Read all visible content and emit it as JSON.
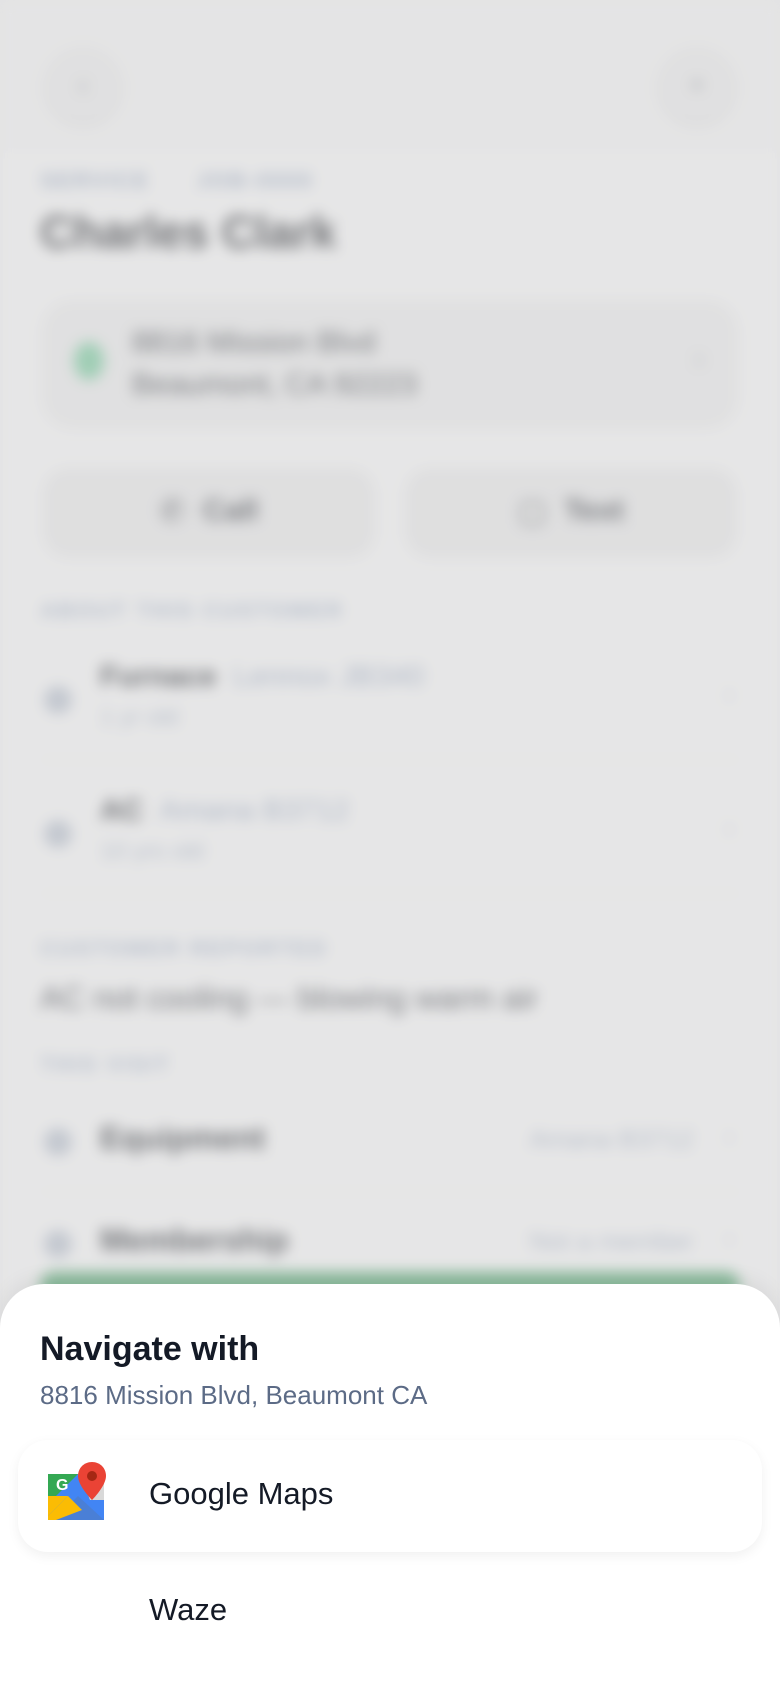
{
  "background": {
    "breadcrumb": [
      "SERVICE",
      "JOB-0000"
    ],
    "customer_name": "Charles Clark",
    "address": {
      "line1": "8816 Mission Blvd",
      "line2": "Beaumont, CA 92223"
    },
    "actions": {
      "call_label": "Call",
      "text_label": "Text"
    },
    "about_label": "ABOUT THIS CUSTOMER",
    "equipment": [
      {
        "name": "Furnace",
        "model": "Lennox JB340",
        "age": "1 yr old"
      },
      {
        "name": "AC",
        "model": "Amana B3712",
        "age": "10 yrs old"
      }
    ],
    "reported_label": "CUSTOMER REPORTED",
    "reported_text": "AC not cooling — blowing warm air",
    "visit_label": "THIS VISIT",
    "details": [
      {
        "label": "Equipment",
        "value": "Amana B3712"
      },
      {
        "label": "Membership",
        "value": "Not a member"
      }
    ]
  },
  "sheet": {
    "title": "Navigate with",
    "subtitle": "8816 Mission Blvd, Beaumont CA",
    "options": [
      {
        "label": "Google Maps",
        "icon": "google-maps-icon",
        "selected": true
      },
      {
        "label": "Waze",
        "icon": "waze-icon",
        "selected": false
      }
    ]
  },
  "colors": {
    "sheet_bg": "#ffffff",
    "title": "#141a26",
    "subtitle": "#5c6b86",
    "accent_green": "#5fa97a"
  }
}
